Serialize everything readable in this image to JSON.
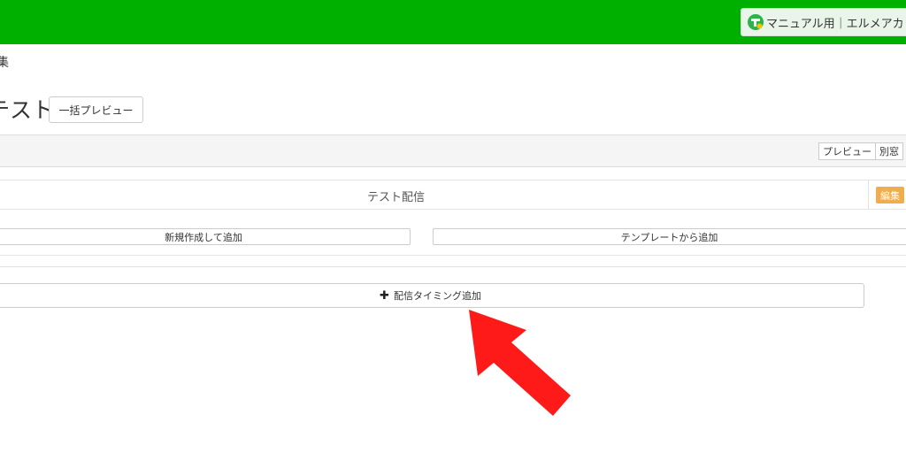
{
  "header": {
    "account_label": "マニュアル用｜エルメアカ",
    "brand_color": "#00b000"
  },
  "breadcrumb": {
    "text": "集"
  },
  "page": {
    "title": "テスト",
    "bulk_preview_label": "一括プレビュー"
  },
  "panel": {
    "preview_label": "プレビュー",
    "separate_window_label": "別窓"
  },
  "message": {
    "title": "テスト配信",
    "edit_label": "編集"
  },
  "actions": {
    "add_new_label": "新規作成して追加",
    "add_template_label": "テンプレートから追加",
    "add_timing_label": "配信タイミング追加"
  },
  "annotation": {
    "arrow_color": "#ff1a1a",
    "arrow_icon": "red-arrow-icon"
  }
}
